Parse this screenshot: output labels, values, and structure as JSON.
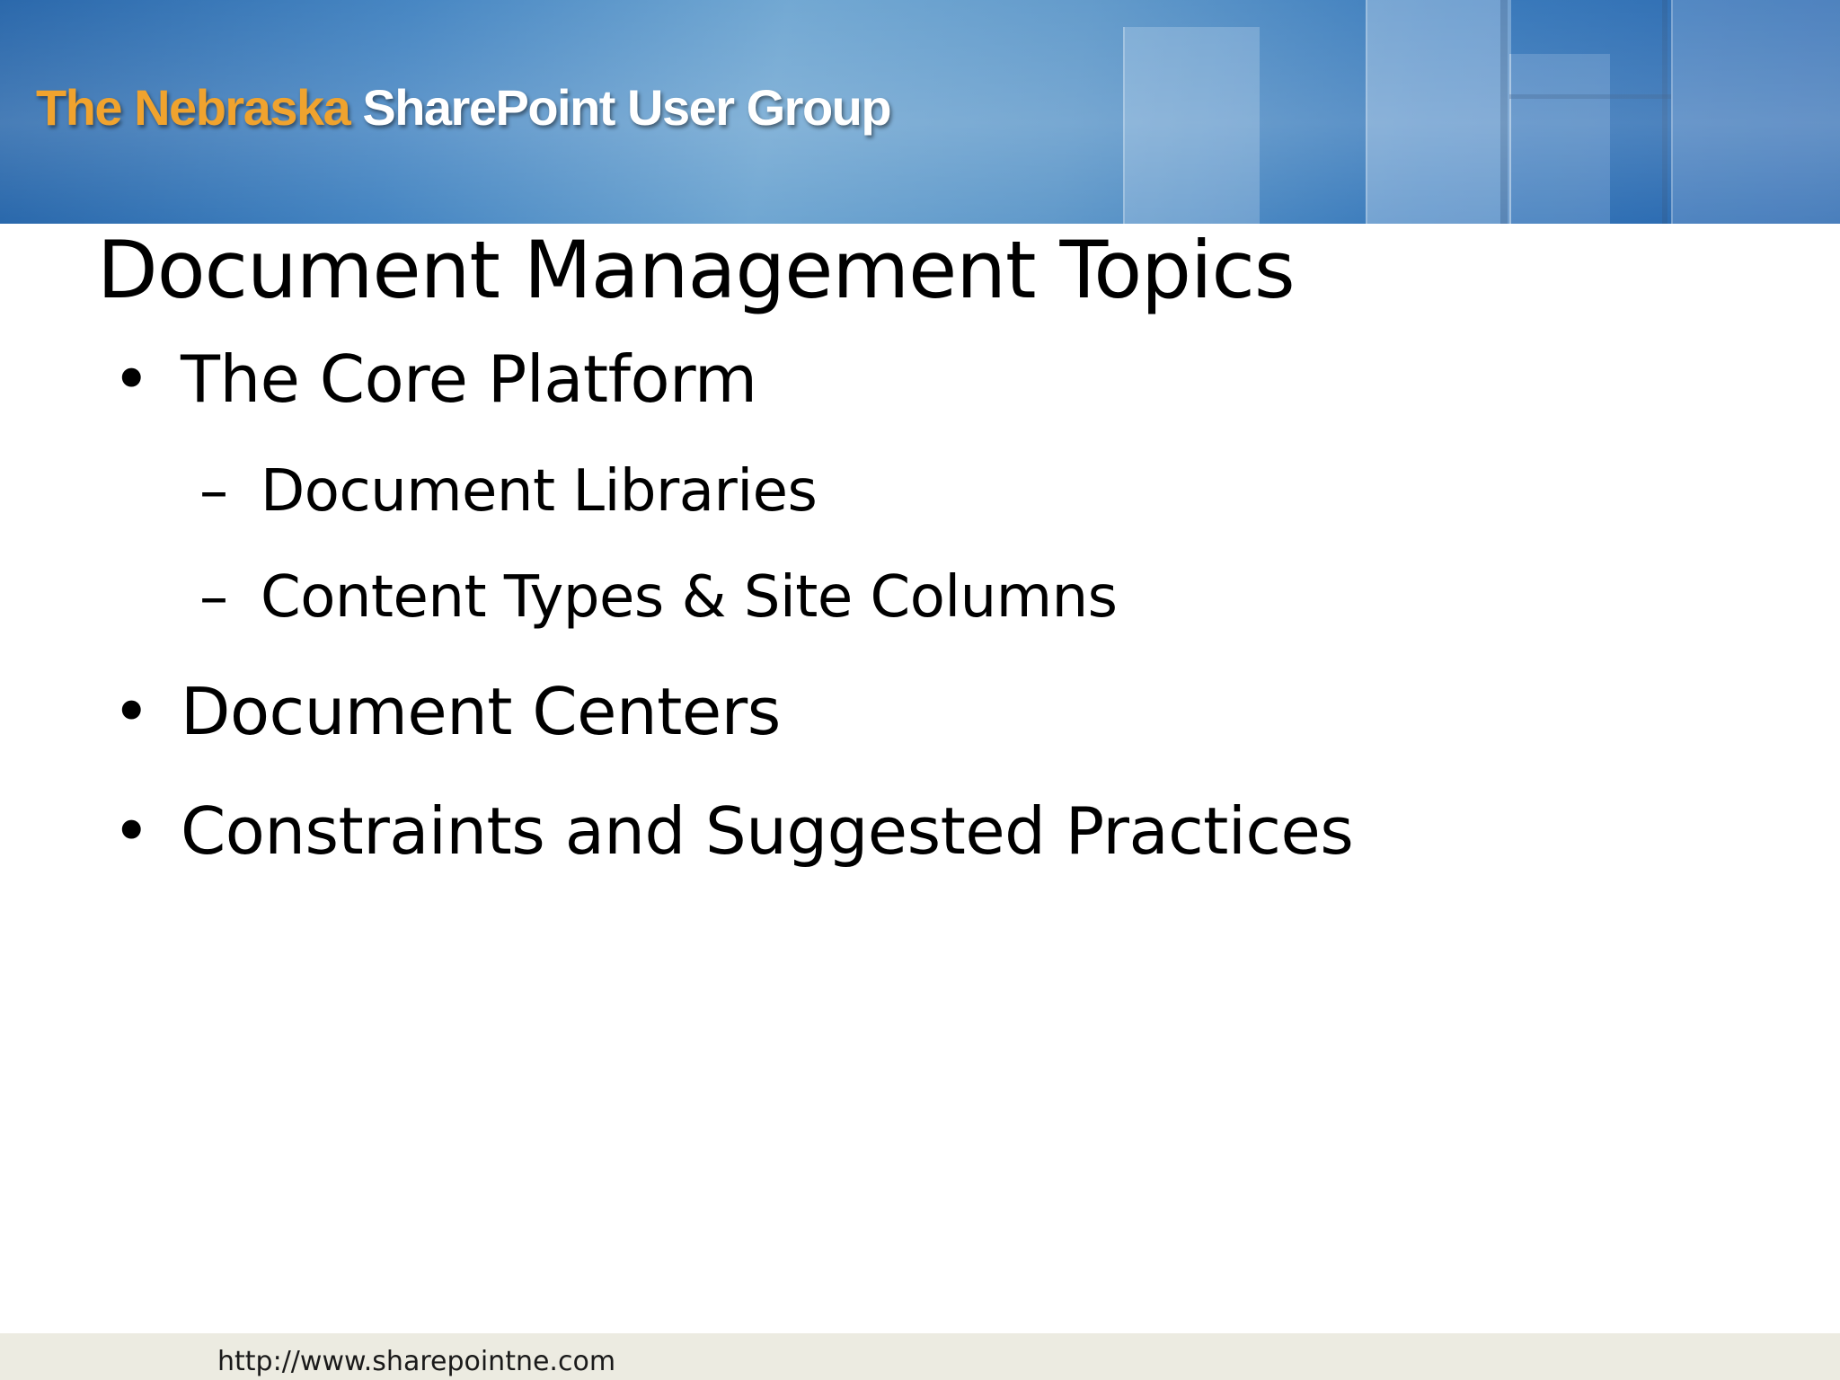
{
  "header": {
    "logo_part1": "The Nebraska",
    "logo_part2": "SharePoint User Group"
  },
  "slide": {
    "title": "Document Management Topics",
    "bullets": [
      {
        "level": 1,
        "marker": "•",
        "text": "The Core Platform"
      },
      {
        "level": 2,
        "marker": "–",
        "text": "Document Libraries"
      },
      {
        "level": 2,
        "marker": "–",
        "text": "Content Types & Site Columns"
      },
      {
        "level": 1,
        "marker": "•",
        "text": "Document Centers"
      },
      {
        "level": 1,
        "marker": "•",
        "text": "Constraints and Suggested Practices"
      }
    ]
  },
  "footer": {
    "url": "http://www.sharepointne.com"
  },
  "colors": {
    "logo_orange": "#f0a32e",
    "banner_blue": "#2f73b8",
    "footer_bg": "#ecebe1"
  }
}
